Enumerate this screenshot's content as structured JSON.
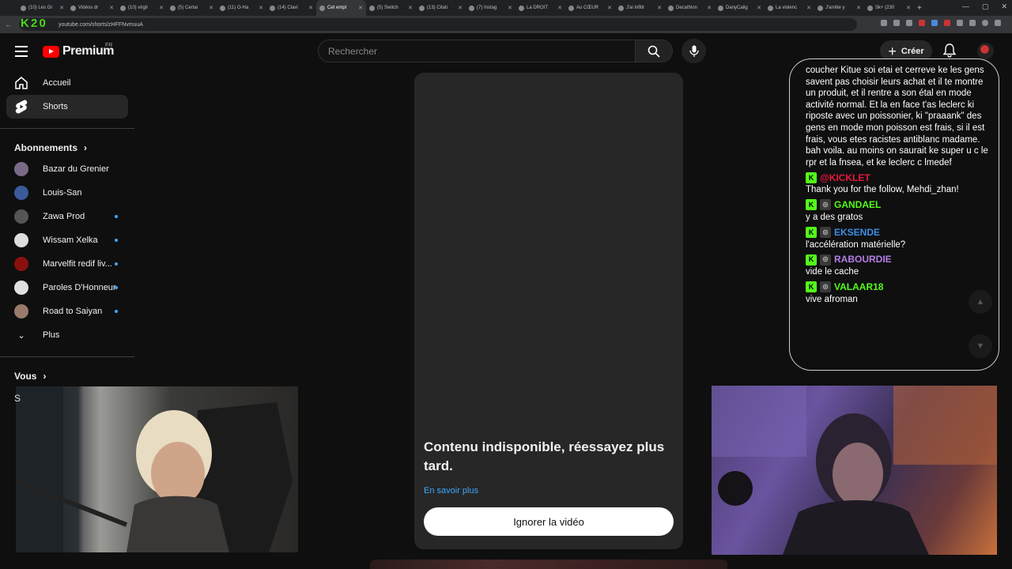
{
  "browser": {
    "tabs": [
      {
        "title": "(10) Les Gr"
      },
      {
        "title": "Vidéos dr"
      },
      {
        "title": "(10) virgil"
      },
      {
        "title": "(5) Certai"
      },
      {
        "title": "(11) O-Ha"
      },
      {
        "title": "(14) Clavi"
      },
      {
        "title": "Cet empl",
        "active": true
      },
      {
        "title": "(5) Switch"
      },
      {
        "title": "(13) Citati"
      },
      {
        "title": "(7) Instag"
      },
      {
        "title": "La DROIT"
      },
      {
        "title": "Au CŒUR"
      },
      {
        "title": "J'ai infiltr"
      },
      {
        "title": "Decathlon"
      },
      {
        "title": "DanyCalig"
      },
      {
        "title": "La violenc"
      },
      {
        "title": "J'arrête y"
      },
      {
        "title": "Sk+ (230"
      }
    ],
    "url": "youtube.com/shorts/zHFFNvmuuA",
    "overlay_logo": "K 2 0"
  },
  "header": {
    "logo_text": "Premium",
    "region": "FR",
    "search_placeholder": "Rechercher",
    "create_label": "Créer"
  },
  "sidebar": {
    "main": [
      {
        "label": "Accueil",
        "icon": "home-icon"
      },
      {
        "label": "Shorts",
        "icon": "shorts-icon",
        "active": true
      }
    ],
    "subscriptions_title": "Abonnements",
    "subscriptions": [
      {
        "label": "Bazar du Grenier",
        "color": "#7a6a8a",
        "dot": false
      },
      {
        "label": "Louis-San",
        "color": "#3a5a9a",
        "dot": false
      },
      {
        "label": "Zawa Prod",
        "color": "#555555",
        "dot": true
      },
      {
        "label": "Wissam Xelka",
        "color": "#dddddd",
        "dot": true
      },
      {
        "label": "Marvelfit redif liv...",
        "color": "#8a1010",
        "dot": true
      },
      {
        "label": "Paroles D'Honneur",
        "color": "#e0e0e0",
        "dot": true
      },
      {
        "label": "Road to Saiyan",
        "color": "#9a7a6a",
        "dot": true
      }
    ],
    "more_label": "Plus",
    "you_title": "Vous"
  },
  "short": {
    "title": "Contenu indisponible, réessayez plus tard.",
    "link": "En savoir plus",
    "button": "Ignorer la vidéo"
  },
  "chat": {
    "intro": "coucher Kitue soi etai et cerreve ke les gens savent pas choisir leurs achat et il te montre un produit, et il rentre a son étal en mode activité normal. Et la en face t'as leclerc ki riposte avec un poissonier, ki \"praaank\" des gens en mode mon poisson est frais, si il est frais, vous etes racistes antiblanc madame. bah voila. au moins on saurait ke super u c le rpr et la fnsea, et ke leclerc c lmedef",
    "messages": [
      {
        "user": "@KICKLET",
        "color": "#e8173f",
        "text": "Thank you for the follow, Mehdi_zhan!",
        "sub": false
      },
      {
        "user": "GANDAEL",
        "color": "#53fc18",
        "text": "y a des gratos",
        "sub": true
      },
      {
        "user": "EKSENDE",
        "color": "#3a8ee6",
        "text": "l'accélération matérielle?",
        "sub": true
      },
      {
        "user": "RABOURDIE",
        "color": "#b47ee5",
        "text": "vide le cache",
        "sub": true
      },
      {
        "user": "VALAAR18",
        "color": "#53fc18",
        "text": "vive afroman",
        "sub": true
      }
    ]
  }
}
